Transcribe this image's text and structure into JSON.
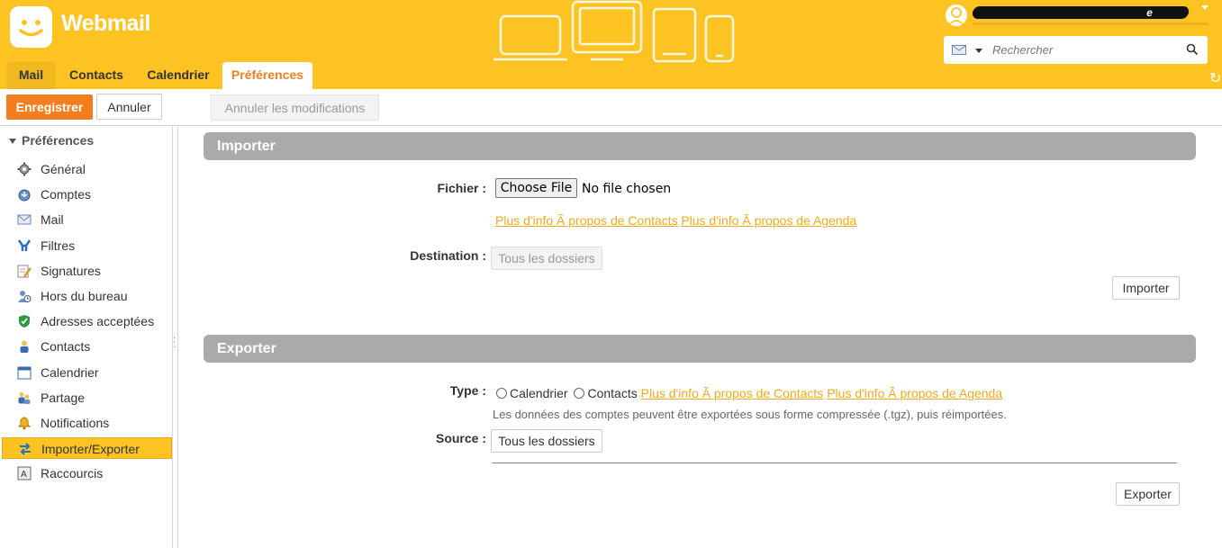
{
  "header": {
    "logo_text": "Webmail",
    "user_name_visible": "e",
    "search_placeholder": "Rechercher",
    "tabs": [
      {
        "label": "Mail"
      },
      {
        "label": "Contacts"
      },
      {
        "label": "Calendrier"
      },
      {
        "label": "Préférences"
      }
    ]
  },
  "toolbar": {
    "save_label": "Enregistrer",
    "cancel_label": "Annuler",
    "undo_label": "Annuler les modifications"
  },
  "sidebar": {
    "title": "Préférences",
    "items": [
      {
        "label": "Général",
        "icon": "gear-icon"
      },
      {
        "label": "Comptes",
        "icon": "accounts-icon"
      },
      {
        "label": "Mail",
        "icon": "mail-icon"
      },
      {
        "label": "Filtres",
        "icon": "filter-icon"
      },
      {
        "label": "Signatures",
        "icon": "signature-icon"
      },
      {
        "label": "Hors du bureau",
        "icon": "out-of-office-icon"
      },
      {
        "label": "Adresses acceptées",
        "icon": "shield-icon"
      },
      {
        "label": "Contacts",
        "icon": "contact-icon"
      },
      {
        "label": "Calendrier",
        "icon": "calendar-icon"
      },
      {
        "label": "Partage",
        "icon": "sharing-icon"
      },
      {
        "label": "Notifications",
        "icon": "bell-icon"
      },
      {
        "label": "Importer/Exporter",
        "icon": "import-export-icon",
        "active": true
      },
      {
        "label": "Raccourcis",
        "icon": "shortcut-icon"
      }
    ]
  },
  "import": {
    "title": "Importer",
    "file_label": "Fichier :",
    "choose_file": "Choose File",
    "no_file": "No file chosen",
    "link_contacts": "Plus d'info Ã  propos de Contacts",
    "link_agenda": "Plus d'info Ã  propos de Agenda",
    "destination_label": "Destination :",
    "destination_value": "Tous les dossiers",
    "import_button": "Importer"
  },
  "export": {
    "title": "Exporter",
    "type_label": "Type :",
    "option_calendar": "Calendrier",
    "option_contacts": "Contacts",
    "link_contacts": "Plus d'info Ã  propos de Contacts",
    "link_agenda": "Plus d'info Ã  propos de Agenda",
    "hint": "Les données des comptes peuvent être exportées sous forme compressée (.tgz), puis réimportées.",
    "source_label": "Source :",
    "source_value": "Tous les dossiers",
    "export_button": "Exporter"
  },
  "colors": {
    "brand_yellow": "#fdc322",
    "accent_orange": "#f47d20",
    "link": "#f2a91b",
    "section_bar": "#aaaaaa"
  }
}
